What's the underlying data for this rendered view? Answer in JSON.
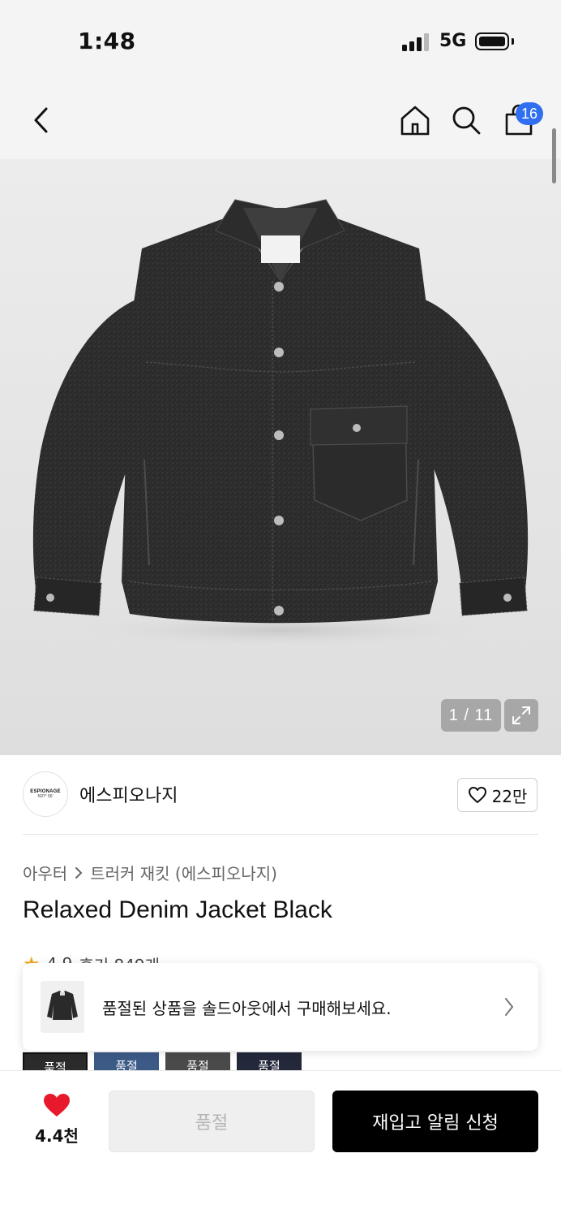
{
  "status_bar": {
    "time": "1:48",
    "network": "5G"
  },
  "nav": {
    "cart_count": "16"
  },
  "image": {
    "counter": "1 / 11"
  },
  "brand": {
    "logo_text": "ESPIONAGE",
    "logo_sub": "N37° 56'",
    "name": "에스피오나지",
    "likes": "22만"
  },
  "breadcrumb": {
    "category": "아우터",
    "subcategory": "트러커 재킷 (에스피오나지)"
  },
  "product": {
    "title": "Relaxed Denim Jacket Black"
  },
  "rating": {
    "score": "4.9",
    "reviews": "후기 849개"
  },
  "banner": {
    "text": "품절된 상품을 솔드아웃에서 구매해보세요."
  },
  "color_thumbs": [
    {
      "label": "품절"
    },
    {
      "label": "품절"
    },
    {
      "label": "품절"
    },
    {
      "label": "품절"
    }
  ],
  "bottom": {
    "wish_count": "4.4천",
    "soldout_label": "품절",
    "restock_label": "재입고 알림 신청"
  },
  "colors": {
    "accent_blue": "#2f6ff0",
    "heart_red": "#e8192c",
    "star": "#f5a623"
  }
}
